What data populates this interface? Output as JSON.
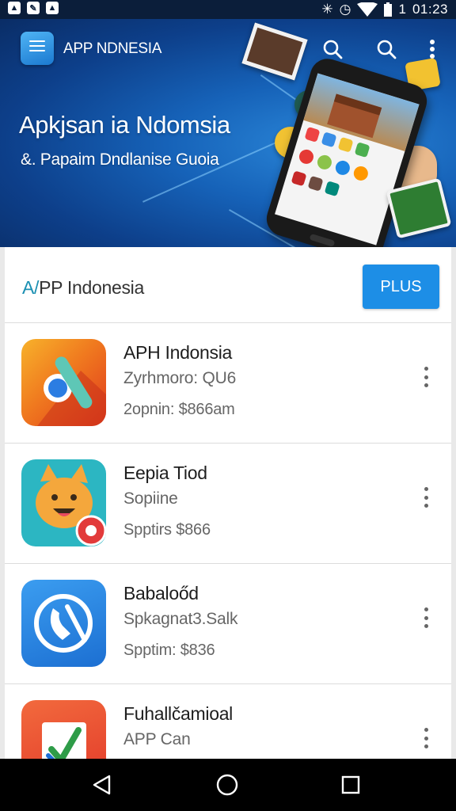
{
  "status_bar": {
    "time": "01:23",
    "left_icons": [
      "image-icon",
      "edit-icon",
      "image-icon"
    ],
    "right_icons": [
      "bluetooth-icon",
      "alarm-icon",
      "wifi-icon",
      "battery-icon"
    ],
    "sim_label": "1"
  },
  "header": {
    "app_title": "APP NDNESIA",
    "icons": [
      "search-icon",
      "search-icon",
      "more-vert-icon"
    ]
  },
  "banner": {
    "heading": "Apkjsan ia Ndomsia",
    "subheading": "&. Papaim Dndlanise Guoia",
    "accent_color": "#1662b8"
  },
  "section": {
    "title_accent": "A/",
    "title_rest": "PP Indonesia",
    "button_label": "PLUS",
    "button_color": "#1d8ee6"
  },
  "apps": [
    {
      "name": "APH Indonsia",
      "line2": "Zyrhmoro: QU6",
      "line3": "2opnin: $866am",
      "icon": "chrome-app-icon"
    },
    {
      "name": "Eepia Tiod",
      "line2": "Sopiine",
      "line3": "Spptirs $866",
      "icon": "cat-app-icon"
    },
    {
      "name": "Babaloőd",
      "line2": "Spkagnat3.Salk",
      "line3": "Spptim: $836",
      "icon": "phone-app-icon"
    },
    {
      "name": "Fuhallčamioal",
      "line2": "APP Can",
      "line3": "",
      "icon": "check-app-icon"
    }
  ],
  "nav": {
    "icons": [
      "back-icon",
      "home-icon",
      "recents-icon"
    ]
  }
}
